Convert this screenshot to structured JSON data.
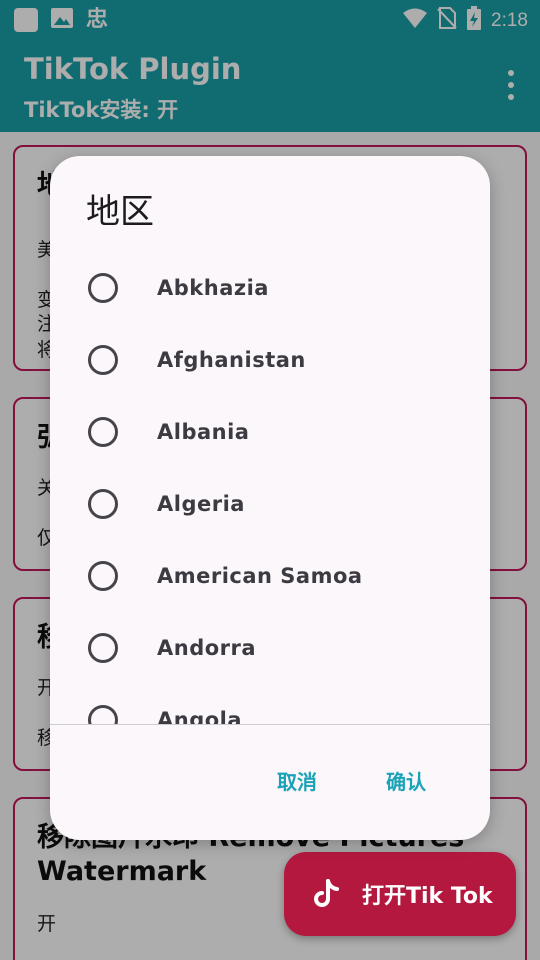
{
  "status_bar": {
    "time": "2:18",
    "left_icons": [
      "white-square-icon",
      "image-icon",
      "chinese-glyph-icon"
    ],
    "left_glyph": "忠",
    "right_icons": [
      "wifi-icon",
      "no-sim-icon",
      "battery-charging-icon"
    ]
  },
  "app_bar": {
    "title": "TikTok Plugin",
    "subtitle": "TikTok安装: 开"
  },
  "background_cards": [
    {
      "title": "地",
      "lines": [
        "美",
        "变",
        "注",
        "将"
      ]
    },
    {
      "title": "弘",
      "lines": [
        "关",
        "仅"
      ]
    },
    {
      "title": "移",
      "lines": [
        "开",
        "移"
      ]
    },
    {
      "title": "移除图片水印 Remove Pictures Watermark",
      "lines": [
        "开"
      ]
    }
  ],
  "dialog": {
    "title": "地区",
    "options": [
      {
        "label": "Abkhazia",
        "selected": false
      },
      {
        "label": "Afghanistan",
        "selected": false
      },
      {
        "label": "Albania",
        "selected": false
      },
      {
        "label": "Algeria",
        "selected": false
      },
      {
        "label": "American Samoa",
        "selected": false
      },
      {
        "label": "Andorra",
        "selected": false
      },
      {
        "label": "Angola",
        "selected": false
      }
    ],
    "cancel_label": "取消",
    "confirm_label": "确认"
  },
  "fab": {
    "label": "打开Tik Tok",
    "icon": "tiktok-icon"
  },
  "colors": {
    "app_bar": "#1a9fa7",
    "accent": "#1aa3b8",
    "card_border": "#c2185b",
    "fab": "#b5183f",
    "dialog_bg": "#fcf7fb"
  }
}
